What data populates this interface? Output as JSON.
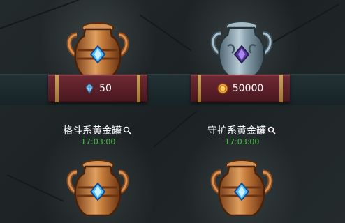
{
  "cards": [
    {
      "jar": "bronze-jar",
      "price": {
        "icon": "crystal-icon",
        "value": "50"
      },
      "title": "格斗系黄金罐",
      "timer": "17:03:00"
    },
    {
      "jar": "silver-jar",
      "price": {
        "icon": "coin-icon",
        "value": "50000"
      },
      "title": "守护系黄金罐",
      "timer": "17:03:00"
    },
    {
      "jar": "bronze-jar"
    },
    {
      "jar": "bronze-jar"
    }
  ],
  "colors": {
    "price_bar": "#5a1f28",
    "timer_green": "#4fc04a",
    "bronze": "#b87333",
    "silver": "#8fa6b2"
  }
}
